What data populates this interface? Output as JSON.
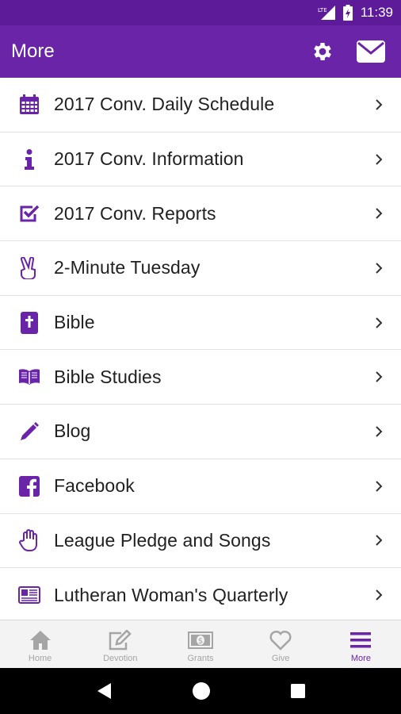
{
  "status_bar": {
    "network": "LTE",
    "time": "11:39"
  },
  "app_bar": {
    "title": "More",
    "icons": [
      "gear-icon",
      "envelope-icon"
    ]
  },
  "menu": {
    "items": [
      {
        "label": "2017 Conv. Daily Schedule",
        "icon": "calendar-icon"
      },
      {
        "label": "2017 Conv. Information",
        "icon": "info-icon"
      },
      {
        "label": "2017 Conv. Reports",
        "icon": "checkbox-icon"
      },
      {
        "label": "2-Minute Tuesday",
        "icon": "peace-hand-icon"
      },
      {
        "label": "Bible",
        "icon": "bible-icon"
      },
      {
        "label": "Bible Studies",
        "icon": "open-book-icon"
      },
      {
        "label": "Blog",
        "icon": "pencil-icon"
      },
      {
        "label": "Facebook",
        "icon": "facebook-icon"
      },
      {
        "label": "League Pledge and Songs",
        "icon": "hand-icon"
      },
      {
        "label": "Lutheran Woman's Quarterly",
        "icon": "newspaper-icon"
      }
    ]
  },
  "tabs": [
    {
      "label": "Home",
      "icon": "home-icon",
      "active": false
    },
    {
      "label": "Devotion",
      "icon": "edit-icon",
      "active": false
    },
    {
      "label": "Grants",
      "icon": "money-icon",
      "active": false
    },
    {
      "label": "Give",
      "icon": "heart-icon",
      "active": false
    },
    {
      "label": "More",
      "icon": "menu-icon",
      "active": true
    }
  ],
  "colors": {
    "primary": "#6a24a8",
    "status_bar": "#5d1a99",
    "inactive_tab": "#a5a5a5"
  }
}
